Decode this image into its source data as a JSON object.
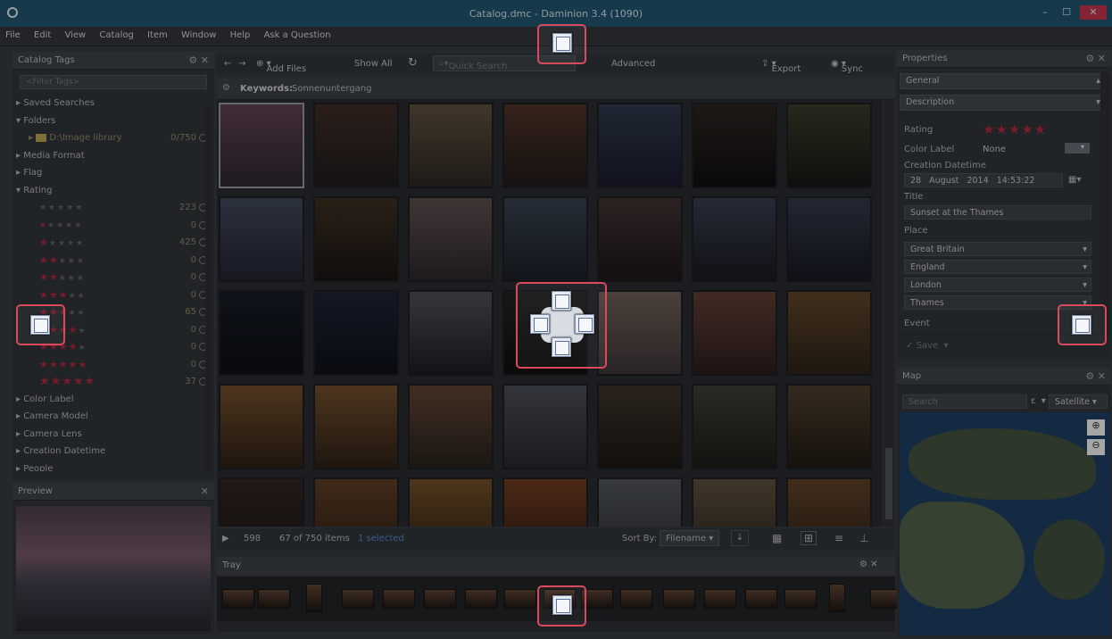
{
  "window": {
    "title": "Catalog.dmc - Daminion 3.4 (1090)",
    "app_icon": "ⓓ"
  },
  "menu": [
    "File",
    "Edit",
    "View",
    "Catalog",
    "Item",
    "Window",
    "Help",
    "Ask a Question"
  ],
  "catalog_tags": {
    "title": "Catalog Tags",
    "filter_placeholder": "<Filter Tags>",
    "saved_searches": "Saved Searches",
    "folders": "Folders",
    "folder_path": "D:\\Image library",
    "folder_count": "0/750",
    "media_format": "Media Format",
    "flag": "Flag",
    "rating": "Rating",
    "rating_counts": [
      "223",
      "0",
      "425",
      "0",
      "0",
      "0",
      "65",
      "0",
      "0",
      "0",
      "37"
    ],
    "bottom_items": [
      "Color Label",
      "Camera Model",
      "Camera Lens",
      "Creation Datetime",
      "People"
    ]
  },
  "preview": {
    "title": "Preview"
  },
  "toolbar": {
    "add_files": "Add Files",
    "show_all": "Show All",
    "quick_search_placeholder": "Quick Search",
    "advanced": "Advanced",
    "export": "Export",
    "sync": "Sync"
  },
  "keywords": {
    "label": "Keywords:",
    "value": "Sonnenuntergang"
  },
  "status": {
    "count": "598",
    "items": "67 of 750 items",
    "selected": "1 selected",
    "sort_label": "Sort By:",
    "sort_value": "Filename"
  },
  "tray": {
    "title": "Tray"
  },
  "properties": {
    "title": "Properties",
    "section_general": "General",
    "section_description": "Description",
    "rating_label": "Rating",
    "rating_value": 5,
    "color_label_label": "Color Label",
    "color_label_value": "None",
    "creation_datetime_label": "Creation Datetime",
    "creation_day": "28",
    "creation_month": "August",
    "creation_year": "2014",
    "creation_time": "14:53:22",
    "title_label": "Title",
    "title_value": "Sunset at the Thames",
    "place_label": "Place",
    "place_values": [
      "Great Britain",
      "England",
      "London",
      "Thames"
    ],
    "event_label": "Event",
    "save_label": "Save"
  },
  "map": {
    "title": "Map",
    "search_placeholder": "Search",
    "map_type": "Satellite"
  },
  "colors": {
    "titlebar": "#1f4f6a",
    "accent_red": "#a8263b",
    "dock_highlight": "#d84a5c",
    "selected_text": "#4d7fc4",
    "folder_count": "#8d7f62"
  }
}
